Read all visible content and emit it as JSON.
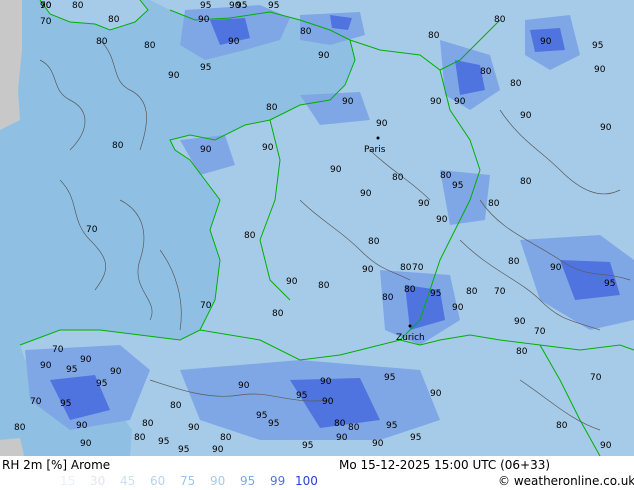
{
  "header": {
    "title": "RH 2m [%] Arome",
    "valid_time": "Mo 15-12-2025 15:00 UTC (06+33)",
    "credit": "© weatheronline.co.uk"
  },
  "legend": {
    "levels": [
      "15",
      "30",
      "45",
      "60",
      "75",
      "90",
      "95",
      "99",
      "100"
    ],
    "colors": [
      "#e8f0f8",
      "#dce8f4",
      "#cbdff2",
      "#b6d4ee",
      "#9fc6ea",
      "#a6cbe8",
      "#7fa7e6",
      "#4f74e0",
      "#2a3fd0"
    ]
  },
  "map": {
    "cities": [
      {
        "name": "Paris"
      },
      {
        "name": "Zurich"
      }
    ],
    "colors": {
      "ocean": "#8fc0e4",
      "land": "#a6cbe8",
      "moist": "#7fa7e6",
      "very_moist": "#4f74e0",
      "border": "#00b000",
      "isoline": "#5a5a5a",
      "offmap": "#c8c8c8"
    },
    "contour_labels": [
      {
        "text": "70"
      },
      {
        "text": "80"
      },
      {
        "text": "80"
      },
      {
        "text": "95"
      },
      {
        "text": "90"
      },
      {
        "text": "95"
      },
      {
        "text": "95"
      },
      {
        "text": "90"
      },
      {
        "text": "80"
      },
      {
        "text": "80"
      },
      {
        "text": "90"
      },
      {
        "text": "95"
      },
      {
        "text": "90"
      },
      {
        "text": "80"
      },
      {
        "text": "90"
      },
      {
        "text": "70"
      },
      {
        "text": "80"
      },
      {
        "text": "80"
      },
      {
        "text": "90"
      },
      {
        "text": "90"
      },
      {
        "text": "80"
      },
      {
        "text": "95"
      },
      {
        "text": "90"
      },
      {
        "text": "80"
      },
      {
        "text": "90"
      },
      {
        "text": "90"
      },
      {
        "text": "90"
      },
      {
        "text": "80"
      },
      {
        "text": "90"
      },
      {
        "text": "90"
      },
      {
        "text": "80"
      },
      {
        "text": "90"
      },
      {
        "text": "90"
      },
      {
        "text": "90"
      },
      {
        "text": "80"
      },
      {
        "text": "90"
      },
      {
        "text": "70"
      },
      {
        "text": "80"
      },
      {
        "text": "90"
      },
      {
        "text": "90"
      },
      {
        "text": "80"
      },
      {
        "text": "95"
      },
      {
        "text": "90"
      },
      {
        "text": "90"
      },
      {
        "text": "80"
      },
      {
        "text": "80"
      },
      {
        "text": "70"
      },
      {
        "text": "80"
      },
      {
        "text": "70"
      },
      {
        "text": "80"
      },
      {
        "text": "80"
      },
      {
        "text": "80"
      },
      {
        "text": "80"
      },
      {
        "text": "90"
      },
      {
        "text": "95"
      },
      {
        "text": "95"
      },
      {
        "text": "80"
      },
      {
        "text": "90"
      },
      {
        "text": "80"
      },
      {
        "text": "90"
      },
      {
        "text": "80"
      },
      {
        "text": "70"
      },
      {
        "text": "70"
      },
      {
        "text": "80"
      },
      {
        "text": "70"
      },
      {
        "text": "95"
      },
      {
        "text": "90"
      },
      {
        "text": "80"
      },
      {
        "text": "95"
      },
      {
        "text": "80"
      },
      {
        "text": "70"
      },
      {
        "text": "90"
      },
      {
        "text": "95"
      },
      {
        "text": "90"
      },
      {
        "text": "95"
      },
      {
        "text": "95"
      },
      {
        "text": "95"
      },
      {
        "text": "90"
      },
      {
        "text": "80"
      },
      {
        "text": "95"
      },
      {
        "text": "90"
      },
      {
        "text": "90"
      },
      {
        "text": "95"
      },
      {
        "text": "90"
      },
      {
        "text": "90"
      },
      {
        "text": "95"
      },
      {
        "text": "90"
      },
      {
        "text": "80"
      },
      {
        "text": "80"
      },
      {
        "text": "90"
      },
      {
        "text": "95"
      },
      {
        "text": "90"
      },
      {
        "text": "80"
      },
      {
        "text": "90"
      },
      {
        "text": "95"
      },
      {
        "text": "95"
      },
      {
        "text": "90"
      },
      {
        "text": "70"
      },
      {
        "text": "80"
      },
      {
        "text": "90"
      },
      {
        "text": "80"
      },
      {
        "text": "90"
      }
    ]
  }
}
